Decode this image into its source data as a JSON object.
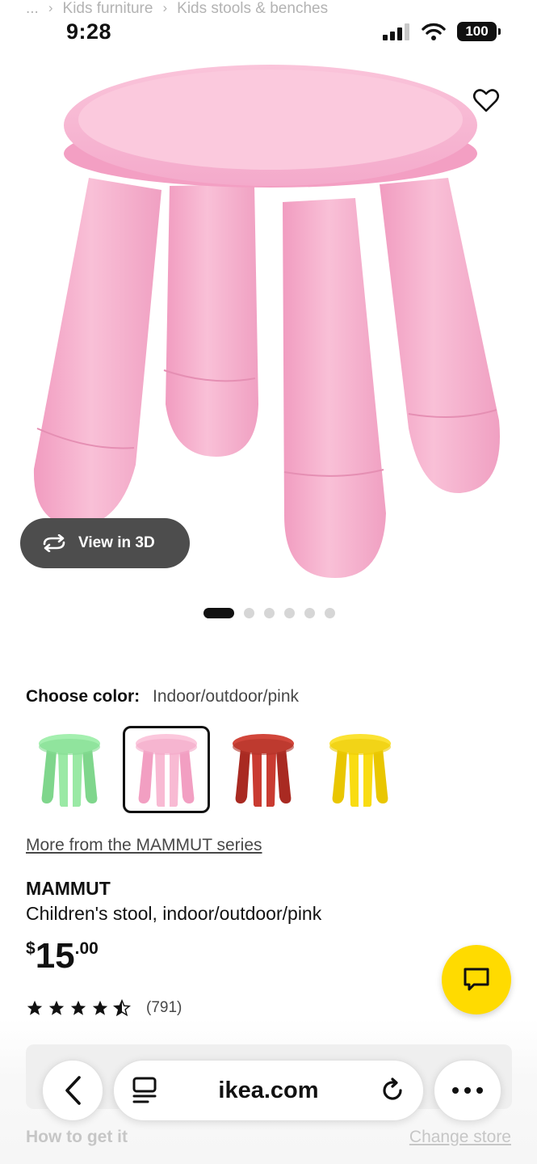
{
  "breadcrumb": {
    "ellipsis": "...",
    "sep1": "›",
    "item1": "Kids furniture",
    "sep2": "›",
    "item2": "Kids stools & benches"
  },
  "status": {
    "time": "9:28",
    "battery": "100"
  },
  "gallery": {
    "view3d_label": "View in 3D",
    "dots_total": 6,
    "active_dot": 1
  },
  "color_picker": {
    "label": "Choose color:",
    "value": "Indoor/outdoor/pink",
    "swatches": [
      {
        "name": "green",
        "color": "#8ee39a"
      },
      {
        "name": "pink",
        "color": "#f6b3ce",
        "selected": true
      },
      {
        "name": "red",
        "color": "#c4392f"
      },
      {
        "name": "yellow",
        "color": "#f8d90f"
      }
    ]
  },
  "product": {
    "series_link": "More from the MAMMUT series",
    "name": "MAMMUT",
    "description": "Children's stool, indoor/outdoor/pink",
    "price_currency": "$",
    "price_int": "15",
    "price_dec": ".00",
    "rating": 4.5,
    "rating_count": "(791)"
  },
  "below": {
    "left": "How to get it",
    "right": "Change store"
  },
  "browser": {
    "url": "ikea.com"
  },
  "colors": {
    "product_pink": "#f7b6cf",
    "accent_yellow": "#ffdb00",
    "pill_dark": "#4d4d4d"
  }
}
